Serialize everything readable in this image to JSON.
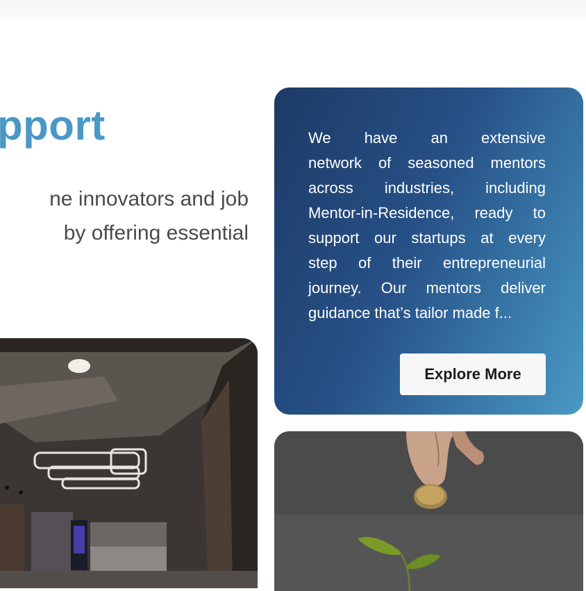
{
  "section": {
    "heading": "pport",
    "description_lines": [
      "ne innovators and job",
      "by offering essential"
    ]
  },
  "mentor_card": {
    "text_lines": [
      "We have an extensive",
      "network of seasoned mentors",
      "across industries, including",
      "Mentor-in-Residence, ready to",
      "support our startups at every",
      "step of their entrepreneurial",
      "journey. Our mentors deliver",
      "guidance that’s tailor made f..."
    ],
    "button_label": "Explore More"
  },
  "colors": {
    "accent": "#4a98c4",
    "card_gradient_start": "#1d3a66",
    "card_gradient_end": "#4b99c4"
  }
}
